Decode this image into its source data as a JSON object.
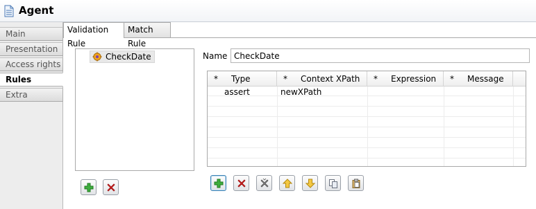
{
  "window": {
    "title": "Agent",
    "title_icon": "document-icon"
  },
  "side_tabs": [
    "Main",
    "Presentation",
    "Access rights",
    "Rules",
    "Extra"
  ],
  "side_active": "Rules",
  "top_tabs": [
    "Validation Rule",
    "Match Rule"
  ],
  "top_active": "Validation Rule",
  "tree": {
    "items": [
      {
        "label": "CheckDate",
        "icon": "rule-gear-icon"
      }
    ]
  },
  "name_field": {
    "label": "Name",
    "value": "CheckDate"
  },
  "table": {
    "columns": [
      "Type",
      "Context XPath",
      "Expression",
      "Message"
    ],
    "required_marker": "*",
    "rows": [
      [
        "assert",
        "newXPath",
        "",
        ""
      ]
    ]
  },
  "colors": {
    "add_green": "#2a9d2a",
    "delete_red": "#d21f1f",
    "arrow_yellow": "#f2c230",
    "focus_blue": "#3c7fb1"
  }
}
